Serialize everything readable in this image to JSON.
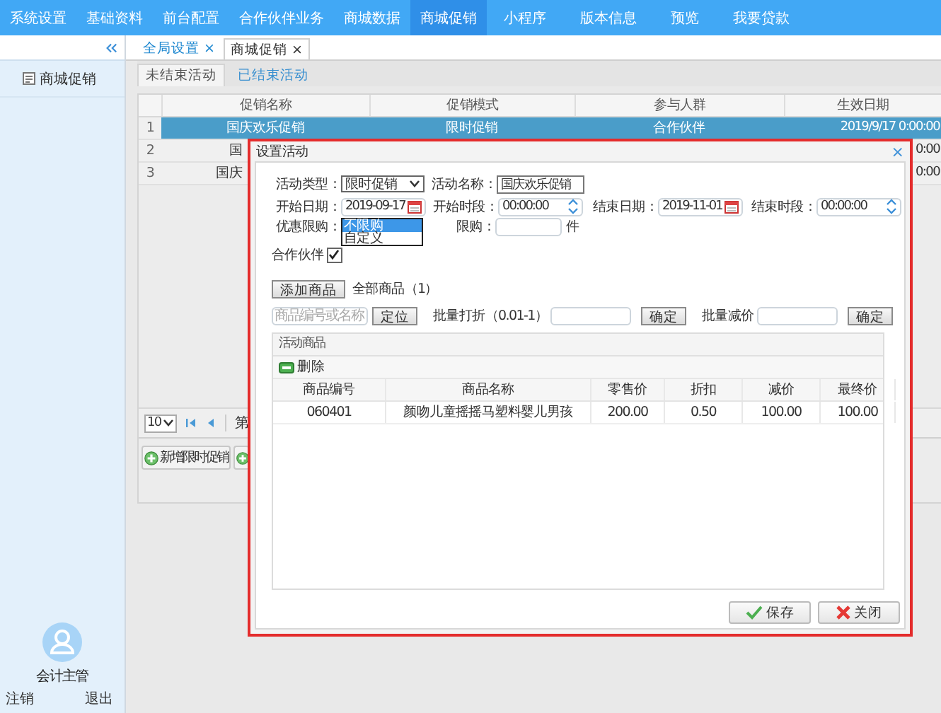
{
  "nav": [
    {
      "label": "系统设置",
      "selected": false
    },
    {
      "label": "基础资料",
      "selected": false
    },
    {
      "label": "前台配置",
      "selected": false
    },
    {
      "label": "合作伙伴业务",
      "selected": false
    },
    {
      "label": "商城数据",
      "selected": false
    },
    {
      "label": "商城促销",
      "selected": true
    },
    {
      "label": "小程序",
      "selected": false
    },
    {
      "label": "版本信息",
      "selected": false
    },
    {
      "label": "预览",
      "selected": false
    },
    {
      "label": "我要贷款",
      "selected": false
    }
  ],
  "sidebar": {
    "items": [
      {
        "label": "商城促销",
        "selected": false
      }
    ],
    "user": {
      "name": "会计主管",
      "links": [
        "注销",
        "退出"
      ]
    }
  },
  "tabs": [
    {
      "label": "全局设置",
      "selected": false,
      "close": "×"
    },
    {
      "label": "商城促销",
      "selected": true,
      "close": "×"
    }
  ],
  "subtabs": [
    {
      "label": "未结束活动",
      "selected": true
    },
    {
      "label": "已结束活动",
      "selected": false
    }
  ],
  "table": {
    "columns": [
      "促销名称",
      "促销模式",
      "参与人群",
      "生效日期"
    ],
    "rows": [
      {
        "number": "1",
        "name": "国庆欢乐促销",
        "mode": "限时促销",
        "group": "合作伙伴",
        "date": "2019/9/17 0:00:00",
        "selected": true
      },
      {
        "number": "2",
        "name": "国",
        "date": "0:00",
        "selected": false
      },
      {
        "number": "3",
        "name": "国庆",
        "date": "0:00",
        "selected": false
      }
    ]
  },
  "pager": {
    "page_size": "10",
    "page_label": "第"
  },
  "actions": [
    {
      "kind": "add",
      "label": "新增限时促销"
    },
    {
      "kind": "add"
    }
  ],
  "dialog": {
    "title": "设置活动",
    "close": "×",
    "form": {
      "activity_type": {
        "label": "活动类型：",
        "value": "限时促销"
      },
      "activity_name": {
        "label": "活动名称：",
        "value": "国庆欢乐促销"
      },
      "start_date": {
        "label": "开始日期：",
        "value": "2019-09-17"
      },
      "start_time": {
        "label": "开始时段：",
        "value": "00:00:00"
      },
      "end_date": {
        "label": "结束日期：",
        "value": "2019-11-01"
      },
      "end_time": {
        "label": "结束时段：",
        "value": "00:00:00"
      },
      "limit_mode": {
        "label": "优惠限购：",
        "options": [
          {
            "label": "不限购",
            "selected": true
          },
          {
            "label": "自定义",
            "selected": false
          }
        ]
      },
      "limit_qty": {
        "label": "限购：",
        "unit": "件"
      },
      "partner": {
        "label": "合作伙伴",
        "checked": true
      }
    },
    "goods_toolbar": {
      "add_button": "添加商品",
      "count": "全部商品（1）",
      "search_placeholder": "商品编号或名称",
      "locate_button": "定位",
      "discount_label": "批量打折（0.01-1）",
      "discount_confirm": "确定",
      "reduce_label": "批量减价",
      "reduce_confirm": "确定"
    },
    "goods": {
      "title": "活动商品",
      "delete_button": "删除",
      "columns": [
        "商品编号",
        "商品名称",
        "零售价",
        "折扣",
        "减价",
        "最终价"
      ],
      "rows": [
        [
          "060401",
          "颜吻儿童摇摇马塑料婴儿男孩",
          "200.00",
          "0.50",
          "100.00",
          "100.00"
        ]
      ]
    },
    "footer": {
      "save": "保存",
      "close": "关闭"
    }
  }
}
